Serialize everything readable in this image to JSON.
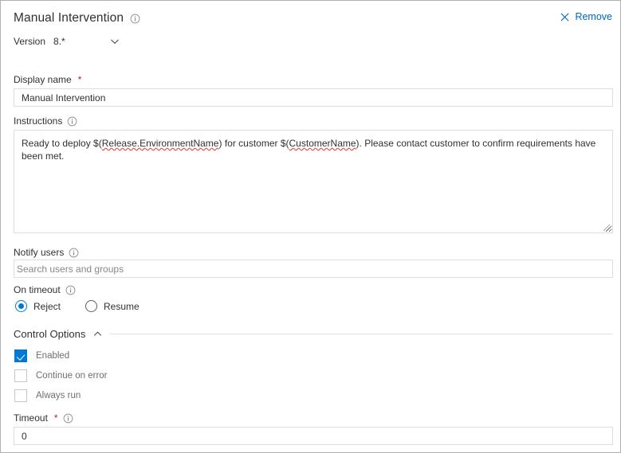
{
  "header": {
    "title": "Manual Intervention",
    "info_icon": "info-icon",
    "remove_label": "Remove",
    "remove_icon": "close-icon"
  },
  "version": {
    "label": "Version",
    "value": "8.*",
    "caret_icon": "chevron-down-icon"
  },
  "fields": {
    "display_name": {
      "label": "Display name",
      "required": "*",
      "value": "Manual Intervention"
    },
    "instructions": {
      "label": "Instructions",
      "info_icon": "info-icon",
      "text_part1": "Ready to deploy $(",
      "text_spell1": "Release.EnvironmentName",
      "text_part2": ") for customer $(",
      "text_spell2": "CustomerName",
      "text_part3": "). Please contact customer to confirm requirements have been met.",
      "full_text": "Ready to deploy $(Release.EnvironmentName) for customer $(CustomerName). Please contact customer to confirm requirements have been met."
    },
    "notify_users": {
      "label": "Notify users",
      "info_icon": "info-icon",
      "placeholder": "Search users and groups",
      "value": ""
    },
    "on_timeout": {
      "label": "On timeout",
      "info_icon": "info-icon",
      "options": [
        {
          "label": "Reject",
          "selected": true
        },
        {
          "label": "Resume",
          "selected": false
        }
      ]
    },
    "timeout": {
      "label": "Timeout",
      "required": "*",
      "info_icon": "info-icon",
      "value": "0"
    }
  },
  "control_options": {
    "title": "Control Options",
    "caret_icon": "chevron-up-icon",
    "checkboxes": [
      {
        "label": "Enabled",
        "checked": true
      },
      {
        "label": "Continue on error",
        "checked": false
      },
      {
        "label": "Always run",
        "checked": false
      }
    ]
  },
  "colors": {
    "accent": "#0078d4",
    "link": "#0067b8",
    "required": "#a4262c",
    "text": "#323130",
    "muted": "#6e6e6e",
    "border": "#dededf",
    "spellcheck": "#e05a4f"
  }
}
